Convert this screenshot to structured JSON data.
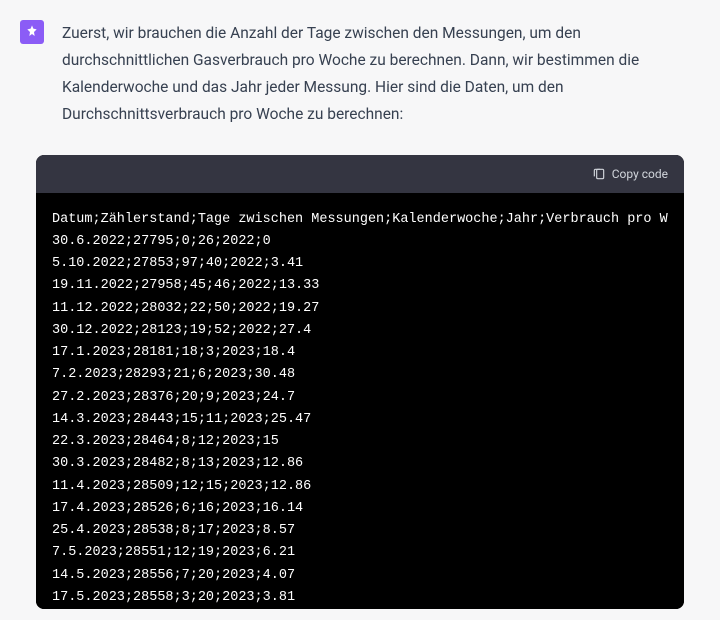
{
  "assistant": {
    "message_text": "Zuerst, wir brauchen die Anzahl der Tage zwischen den Messungen, um den durchschnittlichen Gasverbrauch pro Woche zu berechnen. Dann, wir bestimmen die Kalenderwoche und das Jahr jeder Messung. Hier sind die Daten, um den Durchschnittsverbrauch pro Woche zu berechnen:"
  },
  "code_block": {
    "copy_label": "Copy code",
    "header_line": "Datum;Zählerstand;Tage zwischen Messungen;Kalenderwoche;Jahr;Verbrauch pro W",
    "rows": [
      "30.6.2022;27795;0;26;2022;0",
      "5.10.2022;27853;97;40;2022;3.41",
      "19.11.2022;27958;45;46;2022;13.33",
      "11.12.2022;28032;22;50;2022;19.27",
      "30.12.2022;28123;19;52;2022;27.4",
      "17.1.2023;28181;18;3;2023;18.4",
      "7.2.2023;28293;21;6;2023;30.48",
      "27.2.2023;28376;20;9;2023;24.7",
      "14.3.2023;28443;15;11;2023;25.47",
      "22.3.2023;28464;8;12;2023;15",
      "30.3.2023;28482;8;13;2023;12.86",
      "11.4.2023;28509;12;15;2023;12.86",
      "17.4.2023;28526;6;16;2023;16.14",
      "25.4.2023;28538;8;17;2023;8.57",
      "7.5.2023;28551;12;19;2023;6.21",
      "14.5.2023;28556;7;20;2023;4.07",
      "17.5.2023;28558;3;20;2023;3.81"
    ]
  }
}
